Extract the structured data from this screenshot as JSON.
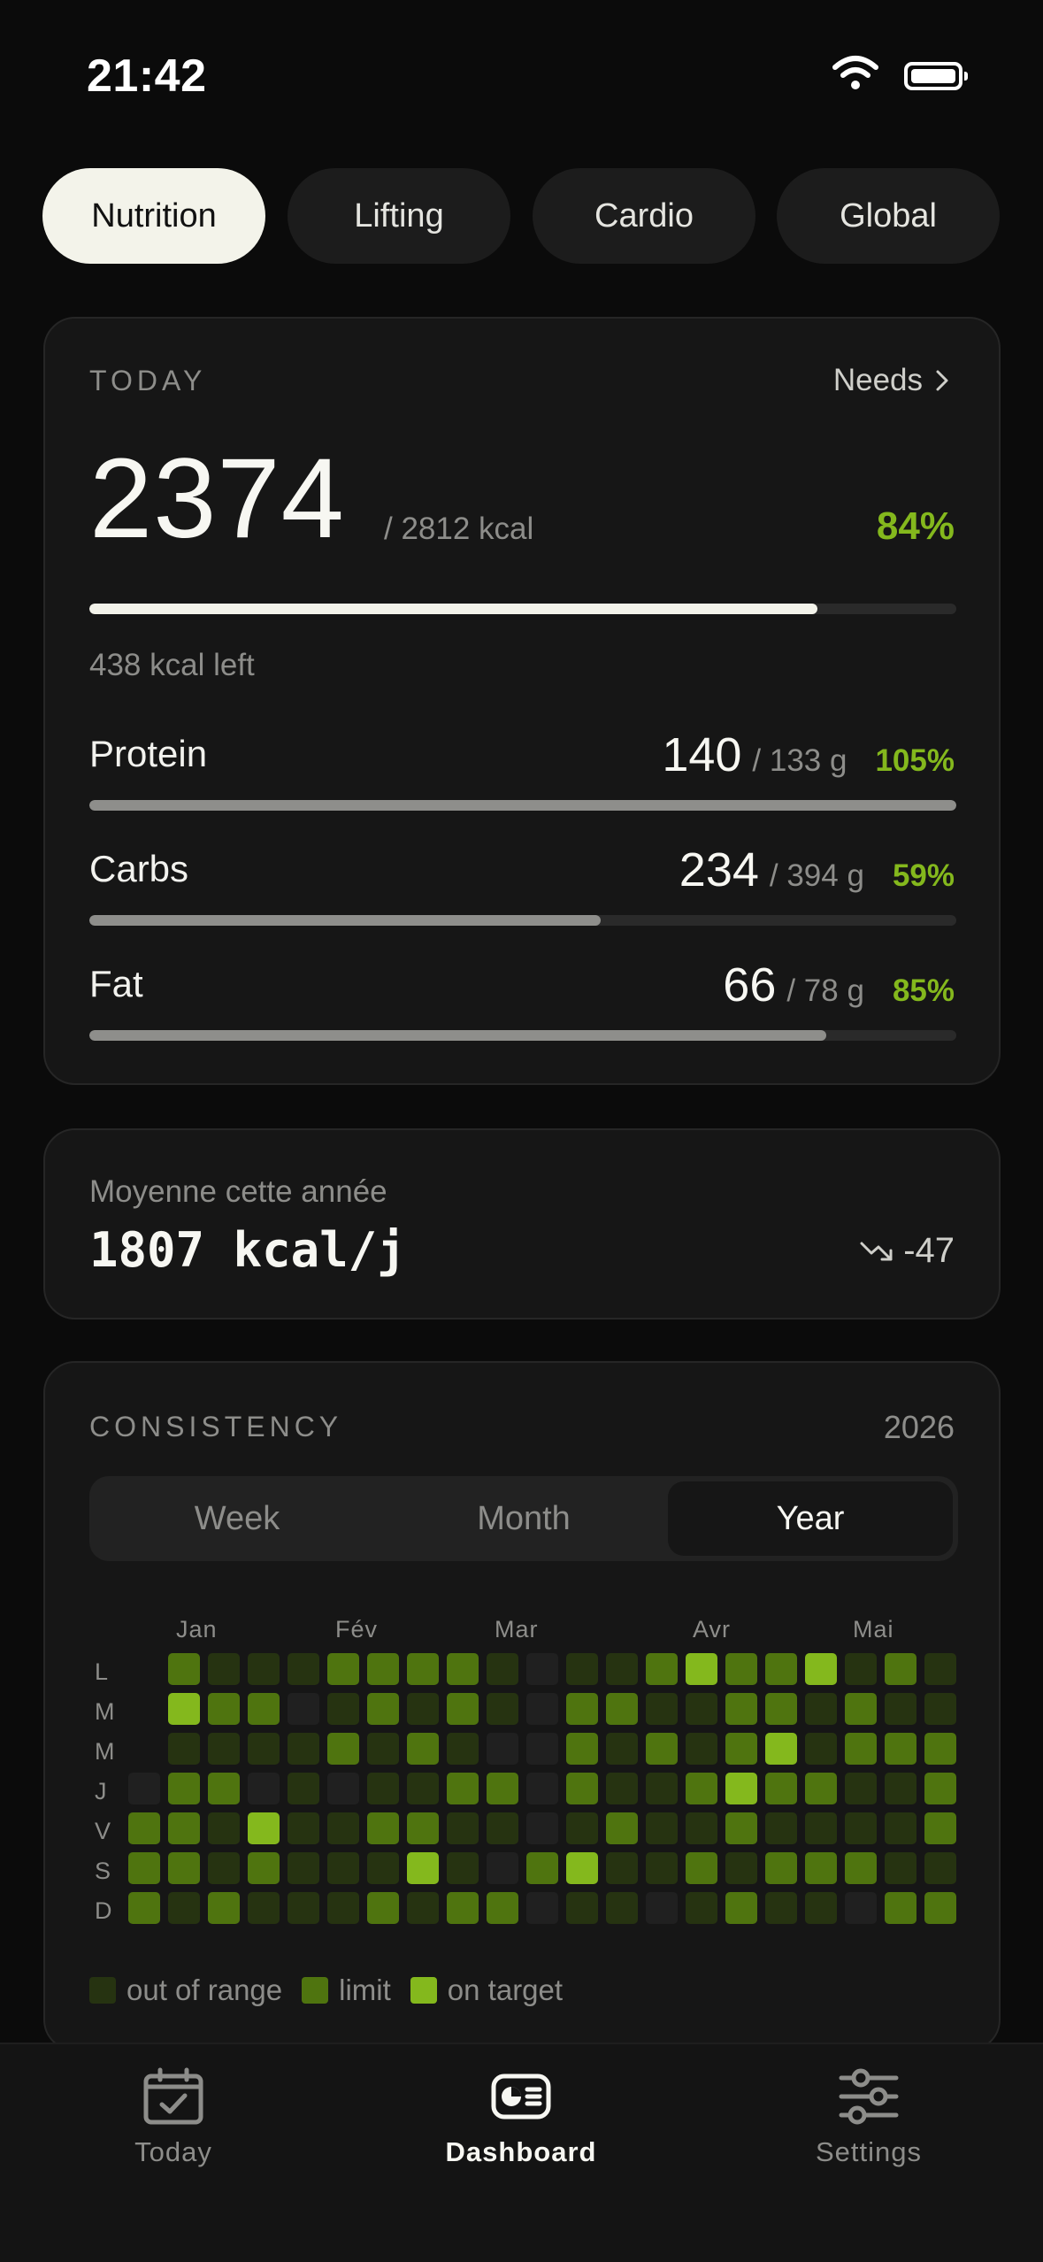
{
  "status_bar": {
    "time": "21:42",
    "wifi_icon": "wifi-icon",
    "battery_icon": "battery-icon"
  },
  "tabs": [
    {
      "label": "Nutrition",
      "active": true
    },
    {
      "label": "Lifting",
      "active": false
    },
    {
      "label": "Cardio",
      "active": false
    },
    {
      "label": "Global",
      "active": false
    }
  ],
  "today": {
    "eyebrow": "TODAY",
    "needs_label": "Needs",
    "needs_icon": "chevron-right-icon",
    "kcal": "2374",
    "kcal_goal": "/ 2812 kcal",
    "percent": "84%",
    "progress": 0.84,
    "left": "438 kcal left",
    "macros": [
      {
        "label": "Protein",
        "value": "140",
        "goal": "/ 133 g",
        "percent": "105%",
        "progress": 1.0
      },
      {
        "label": "Carbs",
        "value": "234",
        "goal": "/ 394 g",
        "percent": "59%",
        "progress": 0.59
      },
      {
        "label": "Fat",
        "value": "66",
        "goal": "/ 78 g",
        "percent": "85%",
        "progress": 0.85
      }
    ]
  },
  "average": {
    "label": "Moyenne cette année",
    "value": "1807 kcal/j",
    "trend_icon": "trend-down-icon",
    "trend": "-47"
  },
  "consistency": {
    "eyebrow": "CONSISTENCY",
    "year": "2026",
    "segments": [
      {
        "label": "Week",
        "active": false
      },
      {
        "label": "Month",
        "active": false
      },
      {
        "label": "Year",
        "active": true
      }
    ],
    "months": [
      "Jan",
      "Fév",
      "Mar",
      "Avr",
      "Mai"
    ],
    "days": [
      "L",
      "M",
      "M",
      "J",
      "V",
      "S",
      "D"
    ],
    "grid": [
      [
        "",
        "2",
        "1",
        "1",
        "1",
        "2",
        "2",
        "2",
        "2",
        "1",
        "0",
        "1",
        "1",
        "2",
        "3",
        "2",
        "2",
        "3",
        "1",
        "2",
        "1"
      ],
      [
        "",
        "3",
        "2",
        "2",
        "0",
        "1",
        "2",
        "1",
        "2",
        "1",
        "0",
        "2",
        "2",
        "1",
        "1",
        "2",
        "2",
        "1",
        "2",
        "1",
        "1"
      ],
      [
        "",
        "1",
        "1",
        "1",
        "1",
        "2",
        "1",
        "2",
        "1",
        "0",
        "0",
        "2",
        "1",
        "2",
        "1",
        "2",
        "3",
        "1",
        "2",
        "2",
        "2"
      ],
      [
        "0",
        "2",
        "2",
        "0",
        "1",
        "0",
        "1",
        "1",
        "2",
        "2",
        "0",
        "2",
        "1",
        "1",
        "2",
        "3",
        "2",
        "2",
        "1",
        "1",
        "2"
      ],
      [
        "2",
        "2",
        "1",
        "3",
        "1",
        "1",
        "2",
        "2",
        "1",
        "1",
        "0",
        "1",
        "2",
        "1",
        "1",
        "2",
        "1",
        "1",
        "1",
        "1",
        "2"
      ],
      [
        "2",
        "2",
        "1",
        "2",
        "1",
        "1",
        "1",
        "3",
        "1",
        "0",
        "2",
        "3",
        "1",
        "1",
        "2",
        "1",
        "2",
        "2",
        "2",
        "1",
        "1"
      ],
      [
        "2",
        "1",
        "2",
        "1",
        "1",
        "1",
        "2",
        "1",
        "2",
        "2",
        "0",
        "1",
        "1",
        "0",
        "1",
        "2",
        "1",
        "1",
        "0",
        "2",
        "2"
      ]
    ],
    "legend": [
      {
        "label": "out of range",
        "level": 1
      },
      {
        "label": "limit",
        "level": 2
      },
      {
        "label": "on target",
        "level": 3
      }
    ],
    "colors": {
      "empty": "#202020",
      "out_of_range": "#263311",
      "limit": "#4f740f",
      "on_target": "#84b81d"
    }
  },
  "bottom_nav": [
    {
      "label": "Today",
      "icon": "calendar-check-icon",
      "active": false
    },
    {
      "label": "Dashboard",
      "icon": "dashboard-icon",
      "active": true
    },
    {
      "label": "Settings",
      "icon": "sliders-icon",
      "active": false
    }
  ]
}
